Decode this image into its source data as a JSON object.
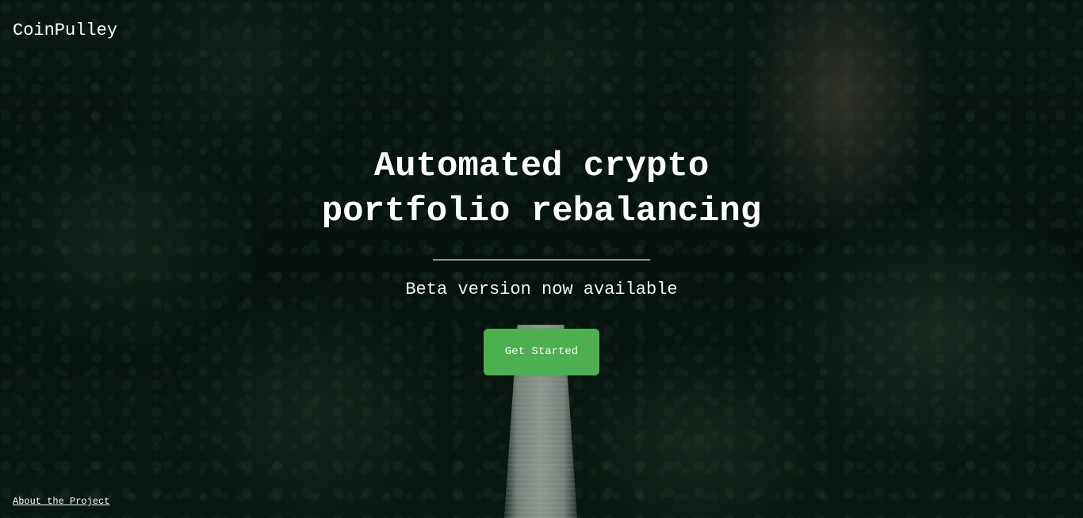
{
  "header": {
    "brand": "CoinPulley"
  },
  "hero": {
    "headline_line1": "Automated crypto",
    "headline_line2": "portfolio rebalancing",
    "tagline": "Beta version now available",
    "cta_label": "Get Started"
  },
  "footer": {
    "about_link": "About the Project"
  },
  "colors": {
    "cta_background": "#4caf50",
    "text": "#ffffff"
  }
}
